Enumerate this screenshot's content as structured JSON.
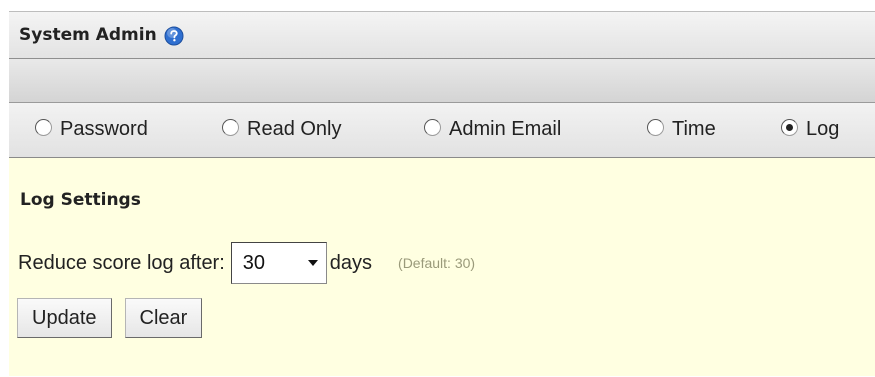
{
  "header": {
    "title": "System Admin",
    "help_icon": "help-icon"
  },
  "tabs": [
    {
      "label": "Password",
      "selected": false
    },
    {
      "label": "Read Only",
      "selected": false
    },
    {
      "label": "Admin Email",
      "selected": false
    },
    {
      "label": "Time",
      "selected": false
    },
    {
      "label": "Log",
      "selected": true
    }
  ],
  "section": {
    "title": "Log Settings"
  },
  "setting": {
    "label": "Reduce score log after:",
    "value": "30",
    "unit": "days",
    "default_note": "(Default: 30)"
  },
  "buttons": {
    "update": "Update",
    "clear": "Clear"
  },
  "colors": {
    "content_background": "#ffffe1",
    "help_icon": "#2f6fd0"
  }
}
